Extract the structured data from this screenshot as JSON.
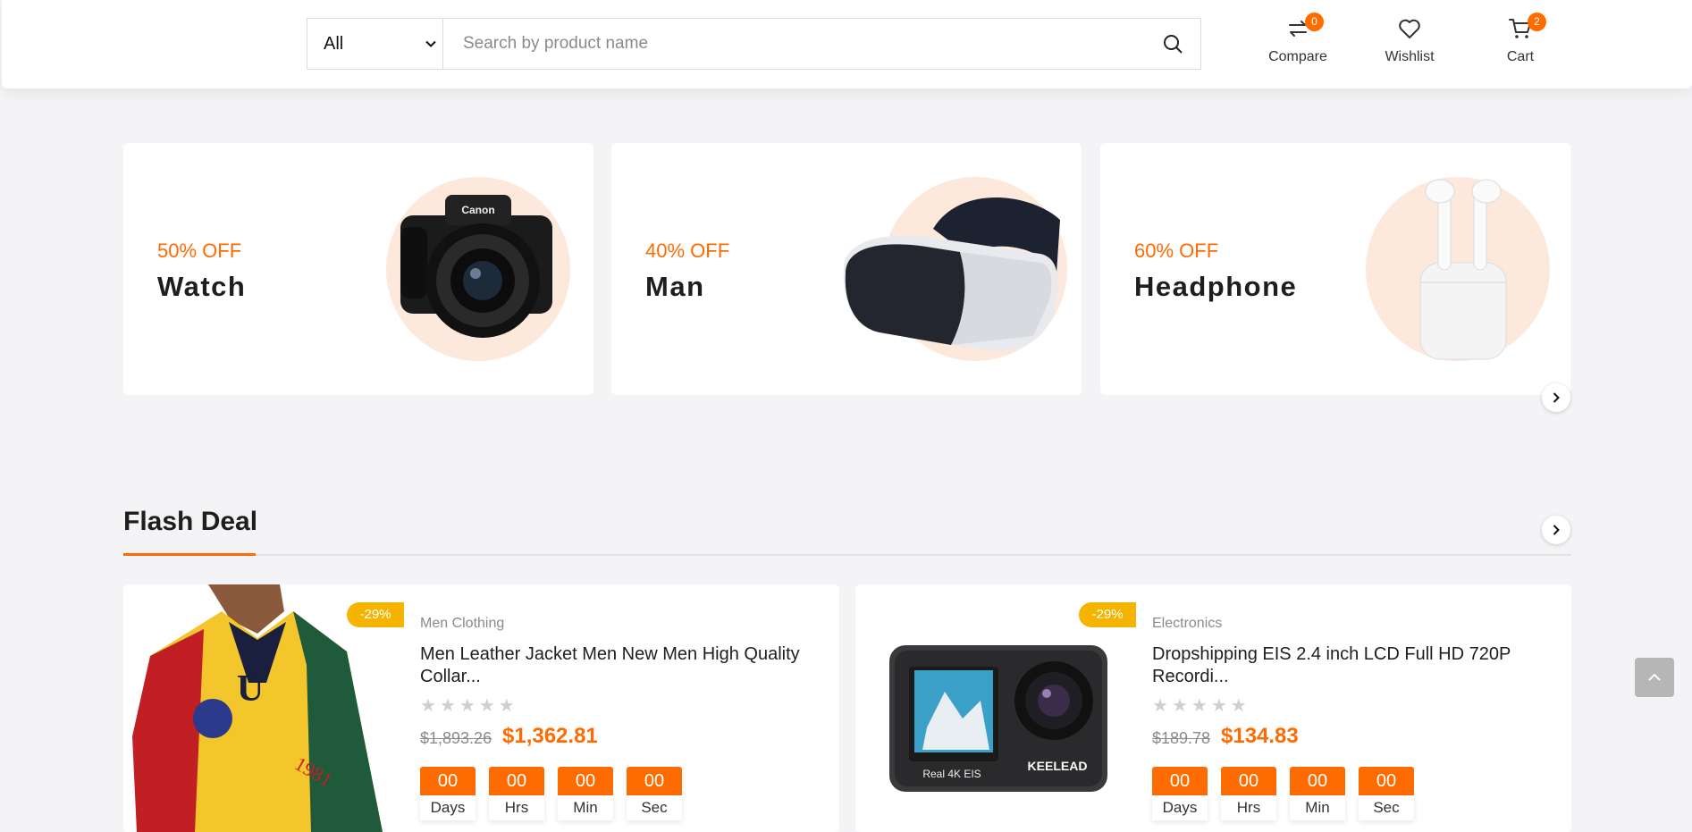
{
  "header": {
    "category_select": "All",
    "search_placeholder": "Search by product name",
    "compare": {
      "label": "Compare",
      "count": "0"
    },
    "wishlist": {
      "label": "Wishlist"
    },
    "cart": {
      "label": "Cart",
      "count": "2"
    }
  },
  "banners": [
    {
      "discount": "50% OFF",
      "title": "Watch",
      "image": "camera"
    },
    {
      "discount": "40% OFF",
      "title": "Man",
      "image": "vr-headset"
    },
    {
      "discount": "60% OFF",
      "title": "Headphone",
      "image": "earbuds"
    }
  ],
  "flash_deal": {
    "title": "Flash Deal",
    "products": [
      {
        "discount": "-29%",
        "category": "Men Clothing",
        "name": "Men Leather Jacket Men New Men High Quality Collar...",
        "old_price": "$1,893.26",
        "price": "$1,362.81",
        "rating": 0,
        "timer": [
          {
            "value": "00",
            "label": "Days"
          },
          {
            "value": "00",
            "label": "Hrs"
          },
          {
            "value": "00",
            "label": "Min"
          },
          {
            "value": "00",
            "label": "Sec"
          }
        ]
      },
      {
        "discount": "-29%",
        "category": "Electronics",
        "name": "Dropshipping EIS 2.4 inch LCD Full HD 720P Recordi...",
        "old_price": "$189.78",
        "price": "$134.83",
        "rating": 0,
        "timer": [
          {
            "value": "00",
            "label": "Days"
          },
          {
            "value": "00",
            "label": "Hrs"
          },
          {
            "value": "00",
            "label": "Min"
          },
          {
            "value": "00",
            "label": "Sec"
          }
        ]
      }
    ]
  },
  "colors": {
    "accent": "#fe6b00",
    "discount_badge": "#f4b400",
    "background": "#f4f4f6"
  }
}
